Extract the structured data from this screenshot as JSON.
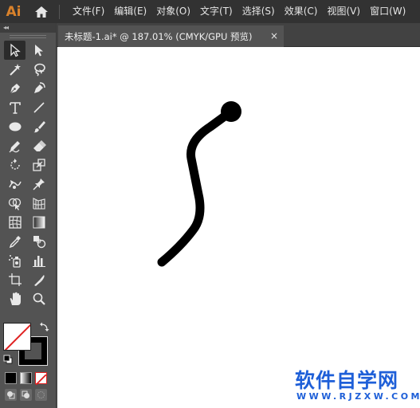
{
  "app": {
    "logo": "Ai"
  },
  "menubar": {
    "items": [
      "文件(F)",
      "编辑(E)",
      "对象(O)",
      "文字(T)",
      "选择(S)",
      "效果(C)",
      "视图(V)",
      "窗口(W)"
    ]
  },
  "document": {
    "tab_title": "未标题-1.ai* @ 187.01% (CMYK/GPU 预览)",
    "close_glyph": "×",
    "zoom_percent": 187.01,
    "color_mode": "CMYK"
  },
  "toolbar": {
    "collapse_glyph": "◂◂",
    "tools": [
      [
        "selection-tool",
        "direct-selection-tool"
      ],
      [
        "magic-wand-tool",
        "lasso-tool"
      ],
      [
        "pen-tool",
        "curvature-tool"
      ],
      [
        "type-tool",
        "line-segment-tool"
      ],
      [
        "ellipse-tool",
        "paintbrush-tool"
      ],
      [
        "shaper-tool",
        "eraser-tool"
      ],
      [
        "rotate-tool",
        "scale-tool"
      ],
      [
        "width-tool",
        "puppet-warp-tool"
      ],
      [
        "shape-builder-tool",
        "perspective-grid-tool"
      ],
      [
        "mesh-tool",
        "gradient-tool"
      ],
      [
        "eyedropper-tool",
        "blend-tool"
      ],
      [
        "symbol-sprayer-tool",
        "column-graph-tool"
      ],
      [
        "artboard-tool",
        "slice-tool"
      ],
      [
        "hand-tool",
        "zoom-tool"
      ]
    ],
    "active_tool": "selection-tool",
    "fill": "none",
    "stroke_color": "#000000"
  },
  "colors": {
    "menubar_bg": "#323232",
    "panel_bg": "#535353",
    "logo": "#d9822b",
    "watermark": "#1e5fd8"
  },
  "watermark": {
    "title": "软件自学网",
    "url": "WWW.RJZXW.COM"
  }
}
